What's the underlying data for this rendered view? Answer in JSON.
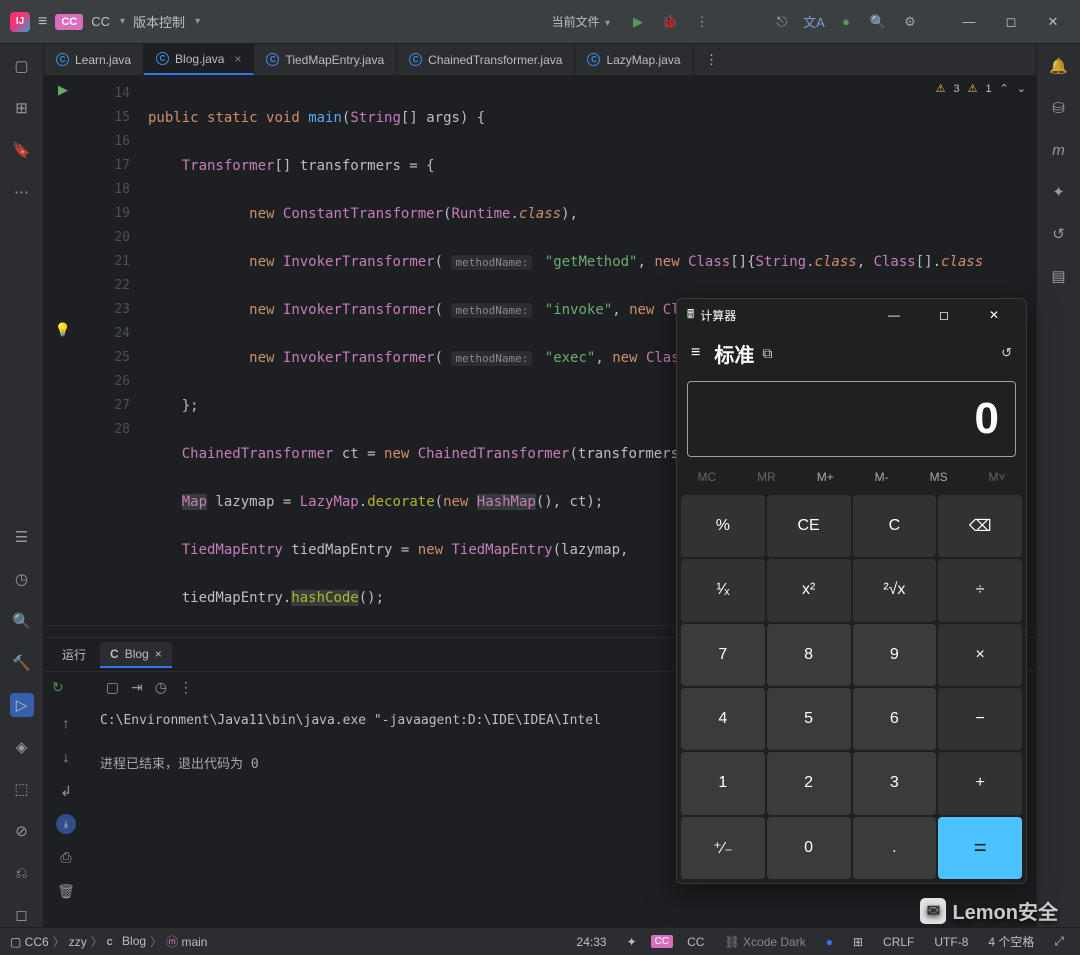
{
  "titlebar": {
    "project_badge": "CC",
    "project_name": "CC",
    "vcs_label": "版本控制",
    "current_file": "当前文件"
  },
  "editor_tabs": [
    {
      "name": "Learn.java",
      "active": false,
      "closeable": false
    },
    {
      "name": "Blog.java",
      "active": true,
      "closeable": true
    },
    {
      "name": "TiedMapEntry.java",
      "active": false,
      "closeable": false
    },
    {
      "name": "ChainedTransformer.java",
      "active": false,
      "closeable": false
    },
    {
      "name": "LazyMap.java",
      "active": false,
      "closeable": false
    }
  ],
  "editor_info": {
    "warn1": "3",
    "warn2": "1"
  },
  "code_lines": {
    "start": 14,
    "count": 15,
    "bulb_at": 24,
    "run_at": 14
  },
  "run_panel": {
    "tab1": "运行",
    "tab2": "Blog",
    "console_line1": "C:\\Environment\\Java11\\bin\\java.exe \"-javaagent:D:\\IDE\\IDEA\\Intel",
    "console_line2": "进程已结束，退出代码为 0"
  },
  "statusbar": {
    "crumbs": [
      "CC6",
      "zzy",
      "Blog",
      "main"
    ],
    "pos": "24:33",
    "cc_badge": "CC",
    "cc_label": "CC",
    "scheme": "Xcode Dark",
    "sep": "CRLF",
    "enc": "UTF-8",
    "indent": "4 个空格"
  },
  "calc": {
    "title": "计算器",
    "mode": "标准",
    "display": "0",
    "mem": [
      "MC",
      "MR",
      "M+",
      "M-",
      "MS",
      "M˅"
    ],
    "buttons": [
      {
        "t": "%",
        "c": "op"
      },
      {
        "t": "CE",
        "c": "op"
      },
      {
        "t": "C",
        "c": "op"
      },
      {
        "t": "⌫",
        "c": "op"
      },
      {
        "t": "¹⁄ₓ",
        "c": "op"
      },
      {
        "t": "x²",
        "c": "op"
      },
      {
        "t": "²√x",
        "c": "op"
      },
      {
        "t": "÷",
        "c": "op"
      },
      {
        "t": "7",
        "c": "num"
      },
      {
        "t": "8",
        "c": "num"
      },
      {
        "t": "9",
        "c": "num"
      },
      {
        "t": "×",
        "c": "op"
      },
      {
        "t": "4",
        "c": "num"
      },
      {
        "t": "5",
        "c": "num"
      },
      {
        "t": "6",
        "c": "num"
      },
      {
        "t": "−",
        "c": "op"
      },
      {
        "t": "1",
        "c": "num"
      },
      {
        "t": "2",
        "c": "num"
      },
      {
        "t": "3",
        "c": "num"
      },
      {
        "t": "+",
        "c": "op"
      },
      {
        "t": "⁺⁄₋",
        "c": "num"
      },
      {
        "t": "0",
        "c": "num"
      },
      {
        "t": ".",
        "c": "num"
      },
      {
        "t": "=",
        "c": "eq"
      }
    ]
  },
  "watermark": "Lemon安全"
}
